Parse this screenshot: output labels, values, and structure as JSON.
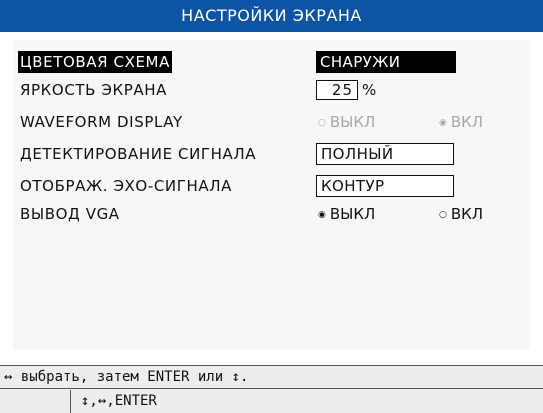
{
  "title": "НАСТРОЙКИ ЭКРАНА",
  "settings": {
    "color_scheme": {
      "label": "ЦВЕТОВАЯ СХЕМА",
      "value": "СНАРУЖИ"
    },
    "brightness": {
      "label": "ЯРКОСТЬ ЭКРАНА",
      "value": "25",
      "unit": "%"
    },
    "waveform": {
      "label": "WAVEFORM DISPLAY",
      "options": [
        "ВЫКЛ",
        "ВКЛ"
      ],
      "selected": "ВКЛ",
      "enabled": false
    },
    "detection": {
      "label": "ДЕТЕКТИРОВАНИЕ СИГНАЛА",
      "value": "ПОЛНЫЙ"
    },
    "echo_display": {
      "label": "ОТОБРАЖ. ЭХО-СИГНАЛА",
      "value": "КОНТУР"
    },
    "vga_output": {
      "label": "ВЫВОД VGA",
      "options": [
        "ВЫКЛ",
        "ВКЛ"
      ],
      "selected": "ВЫКЛ",
      "enabled": true
    }
  },
  "footer": {
    "hint_line1": "↔ выбрать, затем ENTER или ↕.",
    "hint_line2": "↕,↔,ENTER"
  },
  "colors": {
    "title_bar": "#0d55a4",
    "selection": "#000000",
    "panel": "#f7f7f7",
    "disabled_text": "#a8a8a8"
  },
  "icons": {
    "radio_selected": "radio-selected-icon",
    "radio_unselected": "radio-unselected-icon"
  }
}
